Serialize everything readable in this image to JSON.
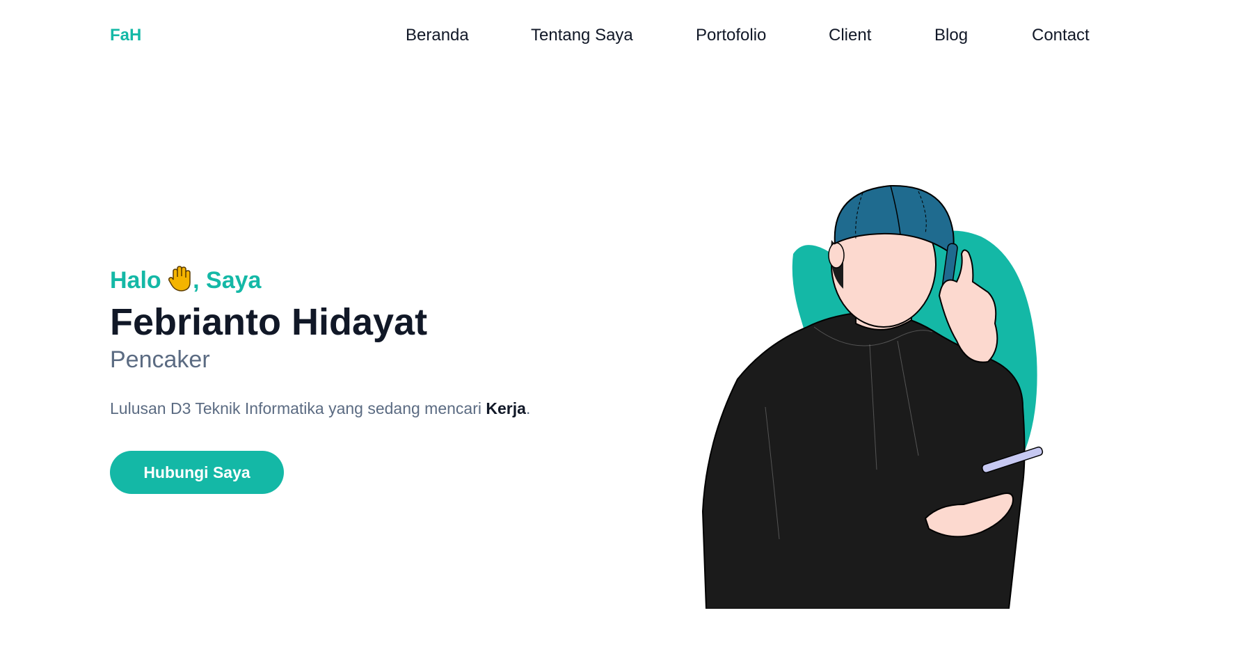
{
  "brand": {
    "logo": "FaH",
    "accent": "#14b8a6"
  },
  "nav": {
    "items": [
      {
        "label": "Beranda"
      },
      {
        "label": "Tentang Saya"
      },
      {
        "label": "Portofolio"
      },
      {
        "label": "Client"
      },
      {
        "label": "Blog"
      },
      {
        "label": "Contact"
      }
    ]
  },
  "hero": {
    "greeting_prefix": "Halo",
    "greeting_suffix": ", Saya",
    "wave_icon": "raised-hand-icon",
    "name": "Febrianto Hidayat",
    "role": "Pencaker",
    "description_prefix": "Lulusan D3 Teknik Informatika yang sedang mencari ",
    "description_bold": "Kerja",
    "description_suffix": ".",
    "cta_label": "Hubungi Saya"
  },
  "illustration": {
    "icon": "person-on-phone-illustration",
    "colors": {
      "blob": "#14b8a6",
      "cap": "#1f6b8f",
      "hoodie": "#1b1b1b",
      "skin": "#fcd9cf",
      "phone": "#c7c9f2"
    }
  }
}
